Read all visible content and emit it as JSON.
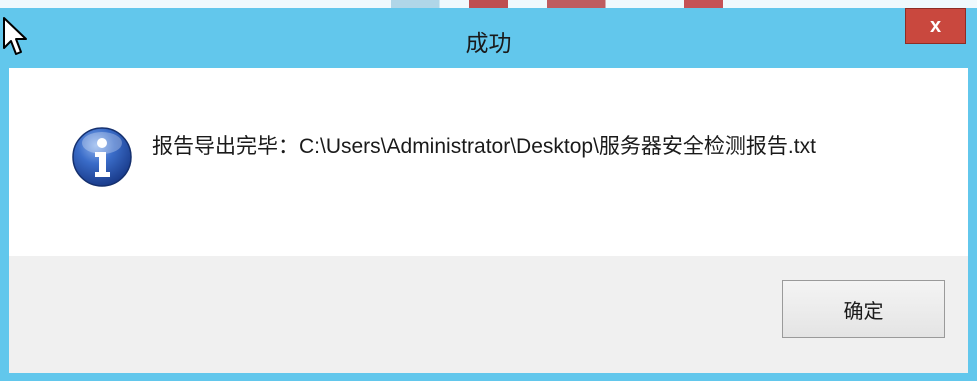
{
  "dialog": {
    "title": "成功",
    "close_label": "x",
    "message": "报告导出完毕：C:\\Users\\Administrator\\Desktop\\服务器安全检测报告.txt",
    "ok_label": "确定"
  },
  "icons": {
    "info": "info-icon",
    "close": "close-icon",
    "cursor": "mouse-cursor-icon"
  },
  "colors": {
    "titlebar": "#62c7ec",
    "close_button": "#c9483e",
    "button_area": "#f0f0f0",
    "info_icon": "#2a56b8"
  }
}
